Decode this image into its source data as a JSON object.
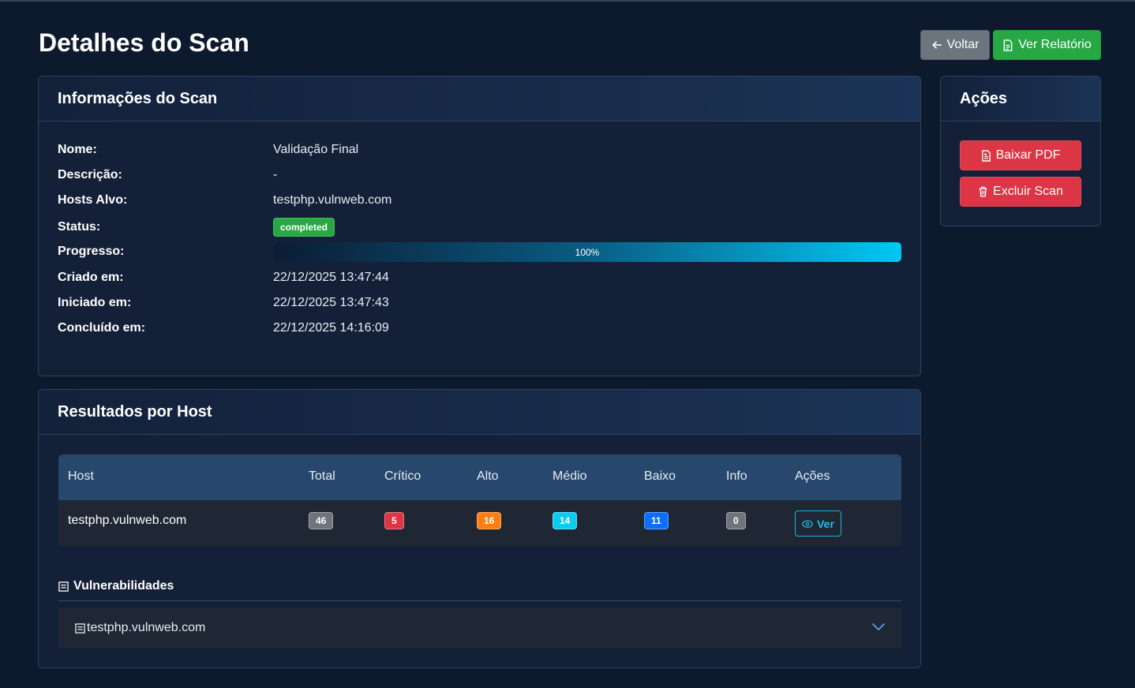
{
  "page": {
    "title": "Detalhes do Scan"
  },
  "toolbar": {
    "back_label": "Voltar",
    "report_label": "Ver Relatório"
  },
  "info": {
    "title": "Informações do Scan",
    "rows": [
      {
        "label": "Nome:",
        "value": "Validação Final"
      },
      {
        "label": "Descrição:",
        "value": "-"
      },
      {
        "label": "Hosts Alvo:",
        "value": "testphp.vulnweb.com"
      },
      {
        "label": "Status:",
        "value": "completed"
      },
      {
        "label": "Progresso:",
        "value": "100%"
      },
      {
        "label": "Criado em:",
        "value": "22/12/2025 13:47:44"
      },
      {
        "label": "Iniciado em:",
        "value": "22/12/2025 13:47:43"
      },
      {
        "label": "Concluído em:",
        "value": "22/12/2025 14:16:09"
      }
    ],
    "progress_percent": 100
  },
  "actions": {
    "title": "Ações",
    "pdf_label": "Baixar PDF",
    "delete_label": "Excluir Scan"
  },
  "results": {
    "title": "Resultados por Host",
    "columns": [
      "Host",
      "Total",
      "Crítico",
      "Alto",
      "Médio",
      "Baixo",
      "Info",
      "Ações"
    ],
    "rows": [
      {
        "host": "testphp.vulnweb.com",
        "total": "46",
        "critico": "5",
        "alto": "16",
        "medio": "14",
        "baixo": "11",
        "info": "0",
        "action_label": "Ver"
      }
    ],
    "badge_colors": {
      "total": "#6c757d",
      "critico": "#dc3545",
      "alto": "#fd7e14",
      "medio": "#0dcaf0",
      "baixo": "#0d6efd",
      "info": "#6c757d"
    },
    "vulns_title": "Vulnerabilidades",
    "accordion_host": "testphp.vulnweb.com"
  }
}
